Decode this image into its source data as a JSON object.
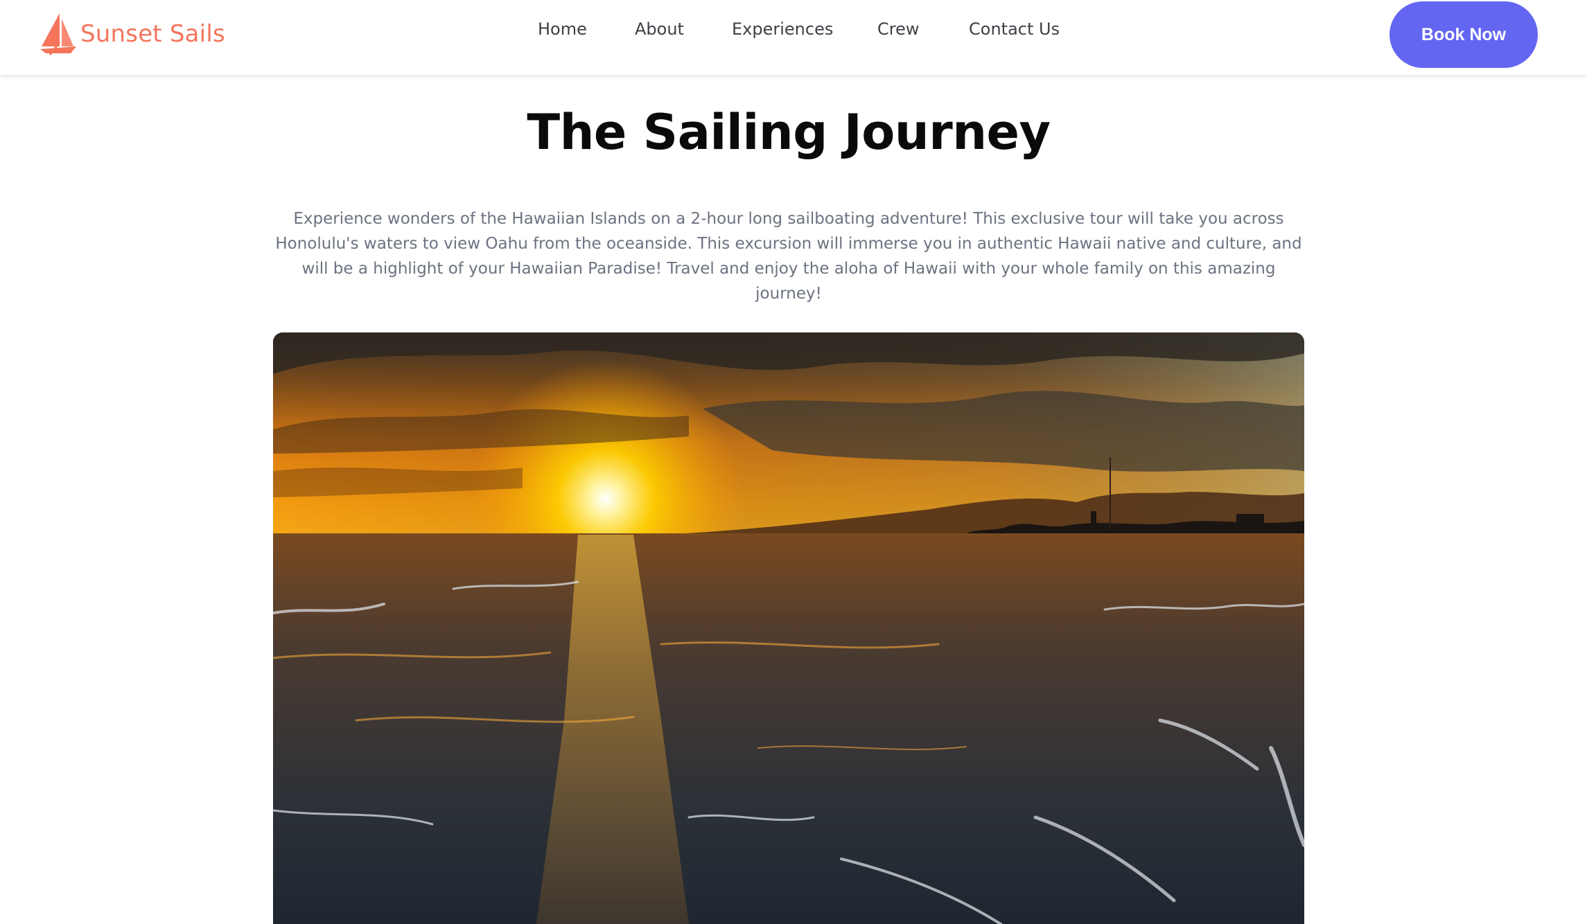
{
  "header": {
    "brand": "Sunset Sails",
    "logo_icon": "sailboat-icon",
    "brand_color": "#f4755c",
    "nav": [
      {
        "label": "Home"
      },
      {
        "label": "About"
      },
      {
        "label": "Experiences"
      },
      {
        "label": "Crew"
      },
      {
        "label": "Contact Us"
      }
    ],
    "cta_label": "Book Now",
    "cta_color": "#6366f1"
  },
  "main": {
    "title": "The Sailing Journey",
    "intro": "Experience wonders of the Hawaiian Islands on a 2-hour long sailboating adventure! This exclusive tour will take you across Honolulu's waters to view Oahu from the oceanside. This excursion will immerse you in authentic Hawaii native and culture, and will be a highlight of your Hawaiian Paradise! Travel and enjoy the aloha of Hawaii with your whole family on this amazing journey!",
    "hero_image": "sunset-ocean-photo"
  }
}
